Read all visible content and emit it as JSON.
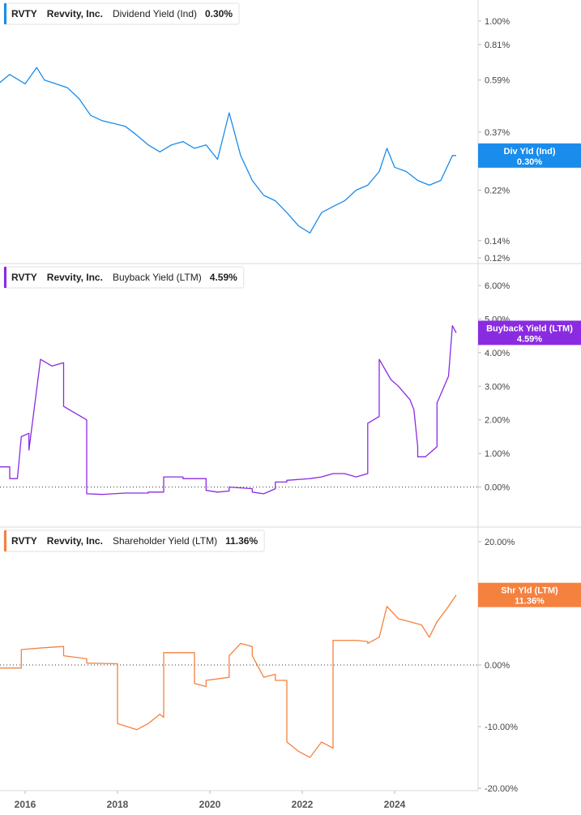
{
  "panels": [
    {
      "ticker": "RVTY",
      "company": "Revvity, Inc.",
      "metric": "Dividend Yield (Ind)",
      "value": "0.30%",
      "badge_line1": "Div Yld (Ind)",
      "badge_line2": "0.30%",
      "color": "#1a8cec"
    },
    {
      "ticker": "RVTY",
      "company": "Revvity, Inc.",
      "metric": "Buyback Yield (LTM)",
      "value": "4.59%",
      "badge_line1": "Buyback Yield (LTM)",
      "badge_line2": "4.59%",
      "color": "#8a2be2"
    },
    {
      "ticker": "RVTY",
      "company": "Revvity, Inc.",
      "metric": "Shareholder Yield (LTM)",
      "value": "11.36%",
      "badge_line1": "Shr Yld (LTM)",
      "badge_line2": "11.36%",
      "color": "#f5813f"
    }
  ],
  "x_axis_labels": [
    "2016",
    "2018",
    "2020",
    "2022",
    "2024"
  ],
  "chart_data": [
    {
      "type": "line",
      "y_scale": "log",
      "ylim": [
        0.12,
        1.0
      ],
      "y_ticks": [
        "1.00%",
        "0.81%",
        "0.59%",
        "0.37%",
        "0.22%",
        "0.14%",
        "0.12%"
      ],
      "y_tick_values": [
        1.0,
        0.81,
        0.59,
        0.37,
        0.22,
        0.14,
        0.12
      ],
      "series": [
        {
          "color": "#1a8cec",
          "x": [
            "2015-06",
            "2015-09",
            "2016-01",
            "2016-04",
            "2016-06",
            "2016-09",
            "2016-12",
            "2017-03",
            "2017-06",
            "2017-09",
            "2017-12",
            "2018-03",
            "2018-06",
            "2018-09",
            "2018-12",
            "2019-03",
            "2019-06",
            "2019-09",
            "2019-12",
            "2020-03",
            "2020-06",
            "2020-09",
            "2020-12",
            "2021-03",
            "2021-06",
            "2021-09",
            "2021-12",
            "2022-03",
            "2022-06",
            "2022-09",
            "2022-12",
            "2023-03",
            "2023-06",
            "2023-09",
            "2023-11",
            "2024-01",
            "2024-04",
            "2024-07",
            "2024-10",
            "2025-01",
            "2025-04",
            "2025-05"
          ],
          "values": [
            0.57,
            0.62,
            0.57,
            0.66,
            0.59,
            0.57,
            0.55,
            0.5,
            0.43,
            0.41,
            0.4,
            0.39,
            0.36,
            0.33,
            0.31,
            0.33,
            0.34,
            0.32,
            0.33,
            0.29,
            0.44,
            0.3,
            0.24,
            0.21,
            0.2,
            0.18,
            0.16,
            0.15,
            0.18,
            0.19,
            0.2,
            0.22,
            0.23,
            0.26,
            0.32,
            0.27,
            0.26,
            0.24,
            0.23,
            0.24,
            0.3,
            0.3
          ]
        }
      ]
    },
    {
      "type": "line",
      "ylim": [
        -0.3,
        6.0
      ],
      "y_ticks": [
        "6.00%",
        "5.00%",
        "4.00%",
        "3.00%",
        "2.00%",
        "1.00%",
        "0.00%"
      ],
      "y_tick_values": [
        6,
        5,
        4,
        3,
        2,
        1,
        0
      ],
      "reference_line": 0,
      "series": [
        {
          "color": "#8a2be2",
          "x": [
            "2015-06",
            "2015-09",
            "2015-09",
            "2015-11",
            "2015-12",
            "2016-02",
            "2016-02",
            "2016-05",
            "2016-08",
            "2016-11",
            "2016-11",
            "2017-02",
            "2017-05",
            "2017-05",
            "2017-09",
            "2018-03",
            "2018-09",
            "2018-09",
            "2019-01",
            "2019-01",
            "2019-06",
            "2019-06",
            "2019-12",
            "2019-12",
            "2020-03",
            "2020-06",
            "2020-06",
            "2020-12",
            "2020-12",
            "2021-03",
            "2021-06",
            "2021-06",
            "2021-09",
            "2021-09",
            "2022-03",
            "2022-06",
            "2022-09",
            "2022-12",
            "2023-03",
            "2023-06",
            "2023-06",
            "2023-09",
            "2023-09",
            "2023-12",
            "2024-02",
            "2024-05",
            "2024-06",
            "2024-07",
            "2024-07",
            "2024-09",
            "2024-12",
            "2024-12",
            "2025-03",
            "2025-04",
            "2025-05"
          ],
          "values": [
            0.6,
            0.6,
            0.25,
            0.25,
            1.5,
            1.6,
            1.1,
            3.8,
            3.6,
            3.7,
            2.4,
            2.2,
            2.0,
            -0.2,
            -0.22,
            -0.18,
            -0.18,
            -0.15,
            -0.15,
            0.3,
            0.3,
            0.25,
            0.25,
            -0.1,
            -0.15,
            -0.12,
            0.0,
            -0.05,
            -0.15,
            -0.2,
            -0.05,
            0.15,
            0.15,
            0.2,
            0.25,
            0.3,
            0.4,
            0.4,
            0.3,
            0.4,
            1.9,
            2.1,
            3.8,
            3.2,
            3.0,
            2.6,
            2.3,
            1.2,
            0.9,
            0.9,
            1.2,
            2.5,
            3.3,
            4.8,
            4.59
          ]
        }
      ]
    },
    {
      "type": "line",
      "ylim": [
        -20,
        20
      ],
      "y_ticks": [
        "20.00%",
        "10.00%",
        "0.00%",
        "-10.00%",
        "-20.00%"
      ],
      "y_tick_values": [
        20,
        10,
        0,
        -10,
        -20
      ],
      "reference_line": 0,
      "series": [
        {
          "color": "#f5813f",
          "x": [
            "2015-06",
            "2015-12",
            "2015-12",
            "2016-06",
            "2016-11",
            "2016-11",
            "2017-05",
            "2017-05",
            "2018-01",
            "2018-01",
            "2018-06",
            "2018-09",
            "2018-12",
            "2019-01",
            "2019-01",
            "2019-09",
            "2019-09",
            "2019-12",
            "2019-12",
            "2020-06",
            "2020-06",
            "2020-09",
            "2020-12",
            "2020-12",
            "2021-03",
            "2021-06",
            "2021-06",
            "2021-09",
            "2021-09",
            "2021-12",
            "2022-03",
            "2022-06",
            "2022-09",
            "2022-09",
            "2023-03",
            "2023-06",
            "2023-06",
            "2023-09",
            "2023-11",
            "2024-02",
            "2024-05",
            "2024-08",
            "2024-10",
            "2024-12",
            "2025-03",
            "2025-05"
          ],
          "values": [
            -0.5,
            -0.5,
            2.5,
            2.8,
            3.0,
            1.5,
            1.0,
            0.3,
            0.2,
            -9.5,
            -10.5,
            -9.5,
            -8.0,
            -8.5,
            2.0,
            2.0,
            -3.0,
            -3.5,
            -2.5,
            -2.0,
            1.5,
            3.5,
            3.0,
            1.5,
            -2.0,
            -1.5,
            -2.5,
            -2.5,
            -12.5,
            -14.0,
            -15.0,
            -12.5,
            -13.5,
            4.0,
            4.0,
            3.8,
            3.5,
            4.5,
            9.5,
            7.5,
            7.0,
            6.5,
            4.5,
            7.0,
            9.5,
            11.36
          ]
        }
      ]
    }
  ]
}
